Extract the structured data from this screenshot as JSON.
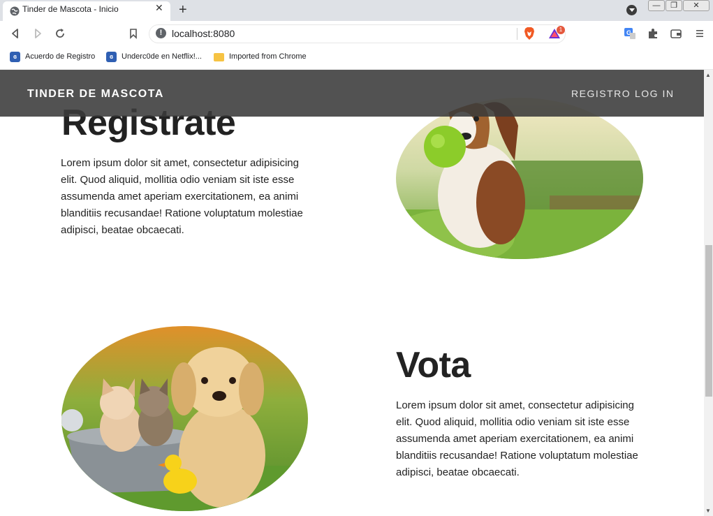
{
  "browser": {
    "tab_title": "Tinder de Mascota - Inicio",
    "tab_close": "✕",
    "new_tab": "+",
    "url": "localhost:8080",
    "rewards_badge": "1",
    "window_controls": {
      "minimize": "—",
      "restore": "❐",
      "close": "✕"
    },
    "bookmarks": [
      {
        "label": "Acuerdo de Registro",
        "icon": "site-icon"
      },
      {
        "label": "Underc0de en Netflix!...",
        "icon": "site-icon"
      },
      {
        "label": "Imported from Chrome",
        "icon": "folder-icon"
      }
    ]
  },
  "site": {
    "brand": "TINDER DE MASCOTA",
    "nav": {
      "registro": "REGISTRO",
      "login": "LOG IN"
    }
  },
  "sections": [
    {
      "title": "Registrate",
      "text": "Lorem ipsum dolor sit amet, consectetur adipisicing elit. Quod aliquid, mollitia odio veniam sit iste esse assumenda amet aperiam exercitationem, ea animi blanditiis recusandae! Ratione voluptatum molestiae adipisci, beatae obcaecati.",
      "image": "beagle-with-ball"
    },
    {
      "title": "Vota",
      "text": "Lorem ipsum dolor sit amet, consectetur adipisicing elit. Quod aliquid, mollitia odio veniam sit iste esse assumenda amet aperiam exercitationem, ea animi blanditiis recusandae! Ratione voluptatum molestiae adipisci, beatae obcaecati.",
      "image": "kittens-and-puppy"
    }
  ]
}
